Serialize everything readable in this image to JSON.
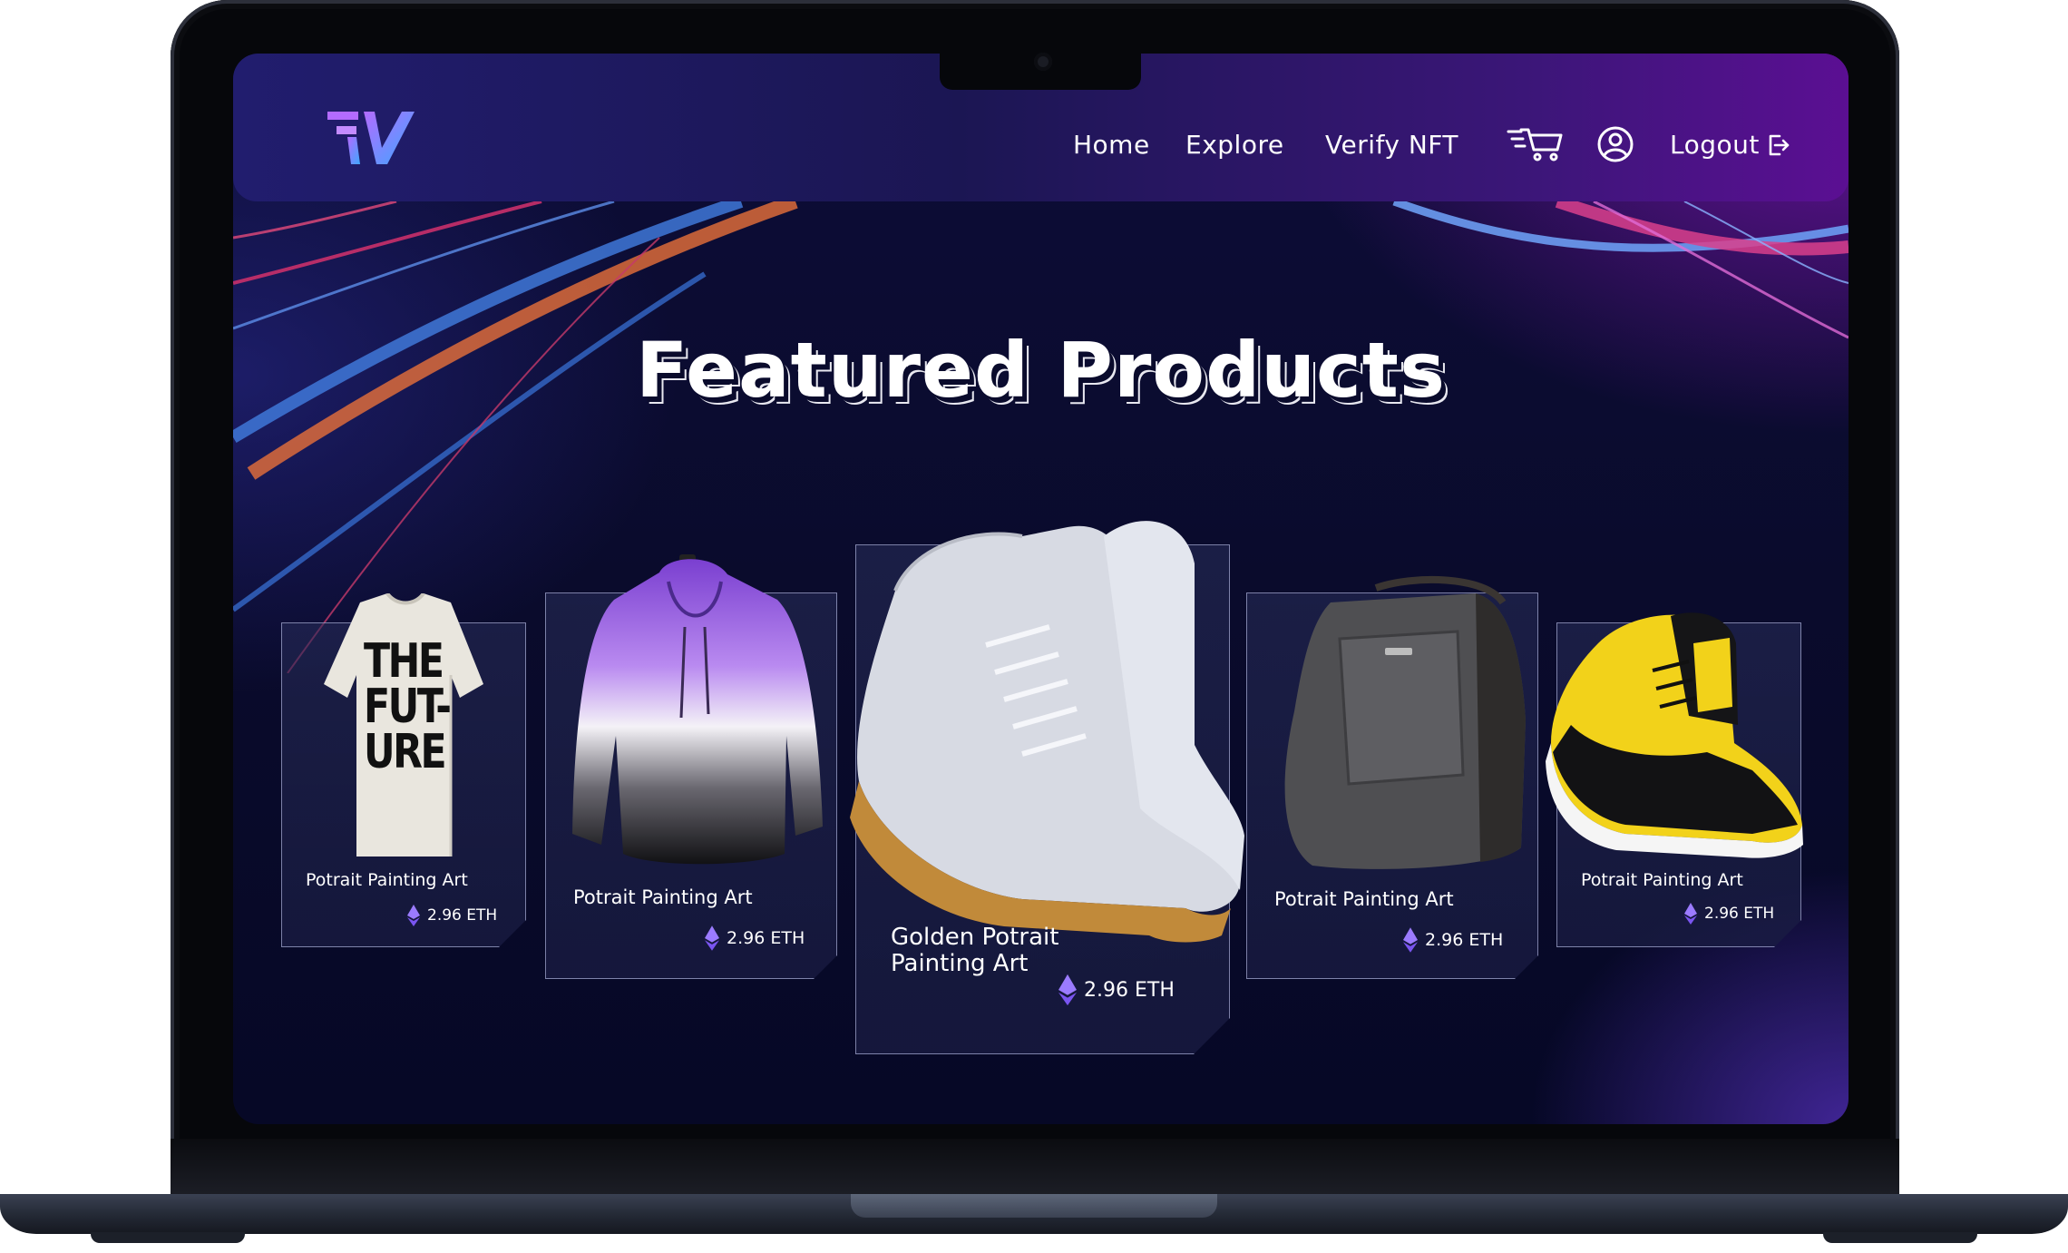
{
  "nav": {
    "home": "Home",
    "explore": "Explore",
    "verify": "Verify NFT",
    "logout": "Logout",
    "icons": [
      "cart-icon",
      "user-icon",
      "logout-icon"
    ]
  },
  "hero": {
    "title": "Featured Products"
  },
  "products": [
    {
      "name": "Potrait Painting Art",
      "price": "2.96 ETH",
      "item": "t-shirt"
    },
    {
      "name": "Potrait Painting Art",
      "price": "2.96 ETH",
      "item": "hoodie"
    },
    {
      "name": "Golden Potrait Painting Art",
      "price": "2.96 ETH",
      "item": "white-sneaker"
    },
    {
      "name": "Potrait Painting Art",
      "price": "2.96 ETH",
      "item": "backpack"
    },
    {
      "name": "Potrait Painting Art",
      "price": "2.96 ETH",
      "item": "yellow-sneaker"
    }
  ],
  "tshirt_print": {
    "l1": "THE",
    "l2": "FUT-",
    "l3": "URE"
  },
  "colors": {
    "accent_purple": "#8b5cf6",
    "accent_blue": "#3b82f6",
    "header_start": "#211d6e",
    "header_end": "#5b0f93"
  }
}
